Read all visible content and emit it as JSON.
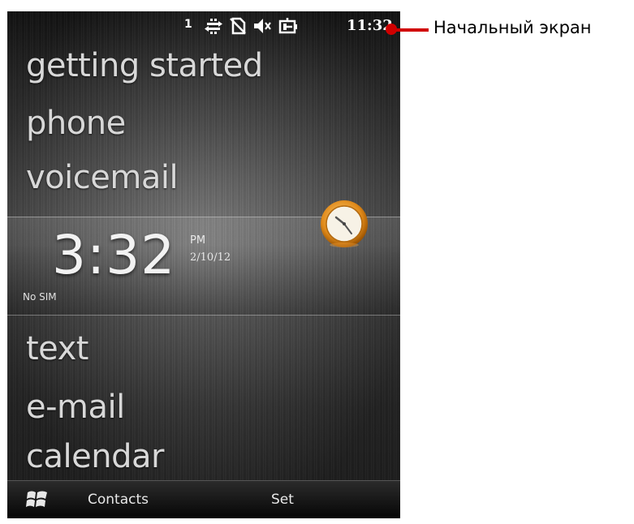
{
  "status_bar": {
    "signal_label": "1",
    "time": "11:32",
    "icons": [
      "data-arrows-icon",
      "no-sim-icon",
      "speaker-muted-icon",
      "battery-plug-icon"
    ]
  },
  "menu": {
    "items": [
      {
        "label": "getting started"
      },
      {
        "label": "phone"
      },
      {
        "label": "voicemail"
      },
      {
        "label": "text"
      },
      {
        "label": "e-mail"
      },
      {
        "label": "calendar"
      }
    ]
  },
  "clock": {
    "time": "3:32",
    "ampm": "PM",
    "date": "2/10/12",
    "sim_status": "No SIM"
  },
  "softkeys": {
    "left": "Contacts",
    "right": "Set"
  },
  "callout": {
    "label": "Начальный экран",
    "color": "#d00000"
  }
}
